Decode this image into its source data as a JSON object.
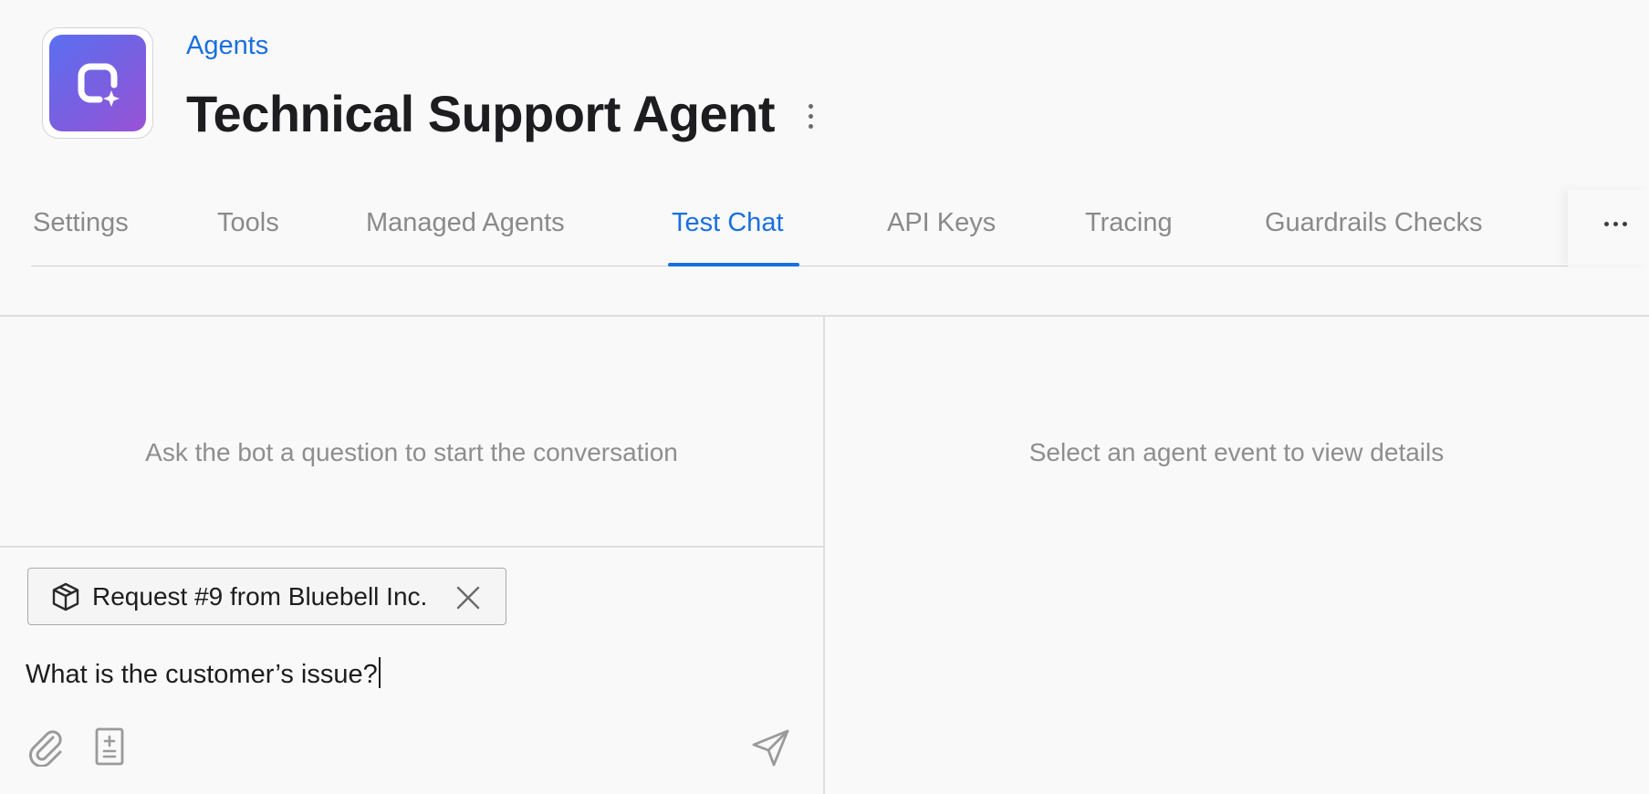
{
  "header": {
    "breadcrumb": "Agents",
    "title": "Technical Support Agent",
    "app_icon": "agent-sparkle-icon",
    "title_menu_icon": "vertical-ellipsis-icon"
  },
  "tabs": {
    "items": [
      {
        "label": "Settings",
        "active": false
      },
      {
        "label": "Tools",
        "active": false
      },
      {
        "label": "Managed Agents",
        "active": false
      },
      {
        "label": "Test Chat",
        "active": true
      },
      {
        "label": "API Keys",
        "active": false
      },
      {
        "label": "Tracing",
        "active": false
      },
      {
        "label": "Guardrails Checks",
        "active": false
      }
    ],
    "more_icon": "horizontal-ellipsis-icon"
  },
  "chat": {
    "empty_text": "Ask the bot a question to start the conversation",
    "context_chip": {
      "label": "Request #9 from Bluebell Inc.",
      "icon": "package-icon",
      "close_icon": "close-icon"
    },
    "input_value": "What is the customer’s issue?",
    "toolbar": {
      "attach_icon": "paperclip-icon",
      "document_icon": "document-add-icon",
      "send_icon": "send-icon"
    }
  },
  "details": {
    "empty_text": "Select an agent event to view details"
  },
  "colors": {
    "accent": "#1a6fdf",
    "icon_gradient_start": "#5a6ff0",
    "icon_gradient_end": "#9a52d6",
    "muted_text": "#8e8e8e",
    "background": "#f9f9f9"
  }
}
